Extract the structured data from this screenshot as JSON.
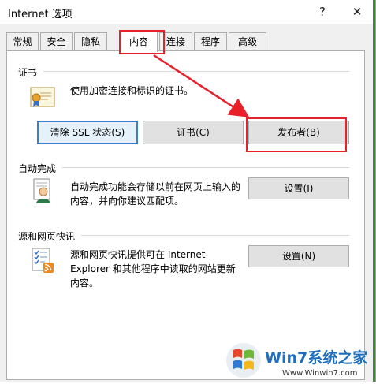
{
  "window": {
    "title": "Internet 选项",
    "help": "?",
    "close": "✕"
  },
  "tabs": [
    {
      "label": "常规"
    },
    {
      "label": "安全"
    },
    {
      "label": "隐私"
    },
    {
      "label": "内容"
    },
    {
      "label": "连接"
    },
    {
      "label": "程序"
    },
    {
      "label": "高级"
    }
  ],
  "certificates": {
    "title": "证书",
    "description": "使用加密连接和标识的证书。",
    "buttons": {
      "clear_ssl": "清除 SSL 状态(S)",
      "certificates": "证书(C)",
      "publishers": "发布者(B)"
    },
    "icon": "certificate-icon"
  },
  "autocomplete": {
    "title": "自动完成",
    "description_line1": "自动完成功能会存储以前在网页上输入的",
    "description_line2": "内容，并向你建议匹配项。",
    "button": "设置(I)",
    "icon": "autocomplete-user-icon"
  },
  "feeds": {
    "title": "源和网页快讯",
    "description_line1": "源和网页快讯提供可在 Internet",
    "description_line2": "Explorer 和其他程序中读取的网站更新",
    "description_line3": "内容。",
    "button": "设置(N)",
    "icon": "rss-feed-icon"
  },
  "watermark": {
    "brand": "Win7系统之家",
    "url": "Www.Winwin7.com"
  },
  "colors": {
    "annotation_red": "#e8202a",
    "focus_blue": "#3c7fd0"
  }
}
